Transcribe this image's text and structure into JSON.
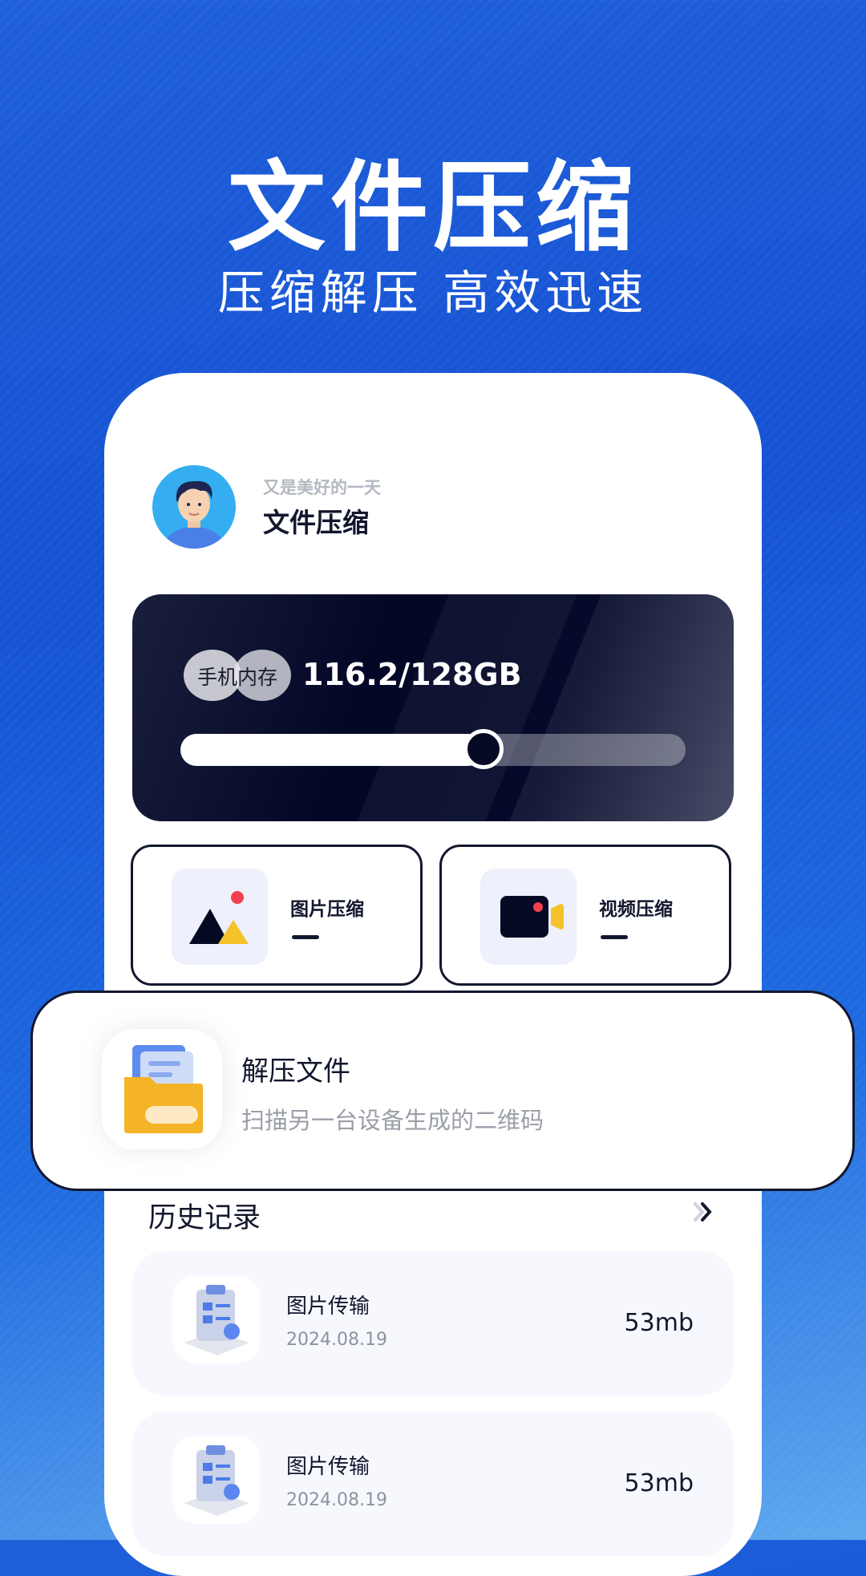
{
  "hero": {
    "title": "文件压缩",
    "subtitle": "压缩解压 高效迅速"
  },
  "profile": {
    "greeting": "又是美好的一天",
    "app_name": "文件压缩"
  },
  "storage": {
    "label": "手机内存",
    "value": "116.2/128GB",
    "progress_percent": 60
  },
  "features": [
    {
      "label": "图片压缩",
      "icon": "image-icon"
    },
    {
      "label": "视频压缩",
      "icon": "video-camera-icon"
    }
  ],
  "unzip": {
    "title": "解压文件",
    "description": "扫描另一台设备生成的二维码",
    "icon": "folder-icon"
  },
  "history": {
    "title": "历史记录",
    "items": [
      {
        "name": "图片传输",
        "date": "2024.08.19",
        "size": "53mb"
      },
      {
        "name": "图片传输",
        "date": "2024.08.19",
        "size": "53mb"
      }
    ]
  },
  "colors": {
    "accent": "#1552d4",
    "dark": "#12172d",
    "card_dark": "#030726",
    "yellow": "#f5c22a",
    "red": "#f2404f"
  }
}
